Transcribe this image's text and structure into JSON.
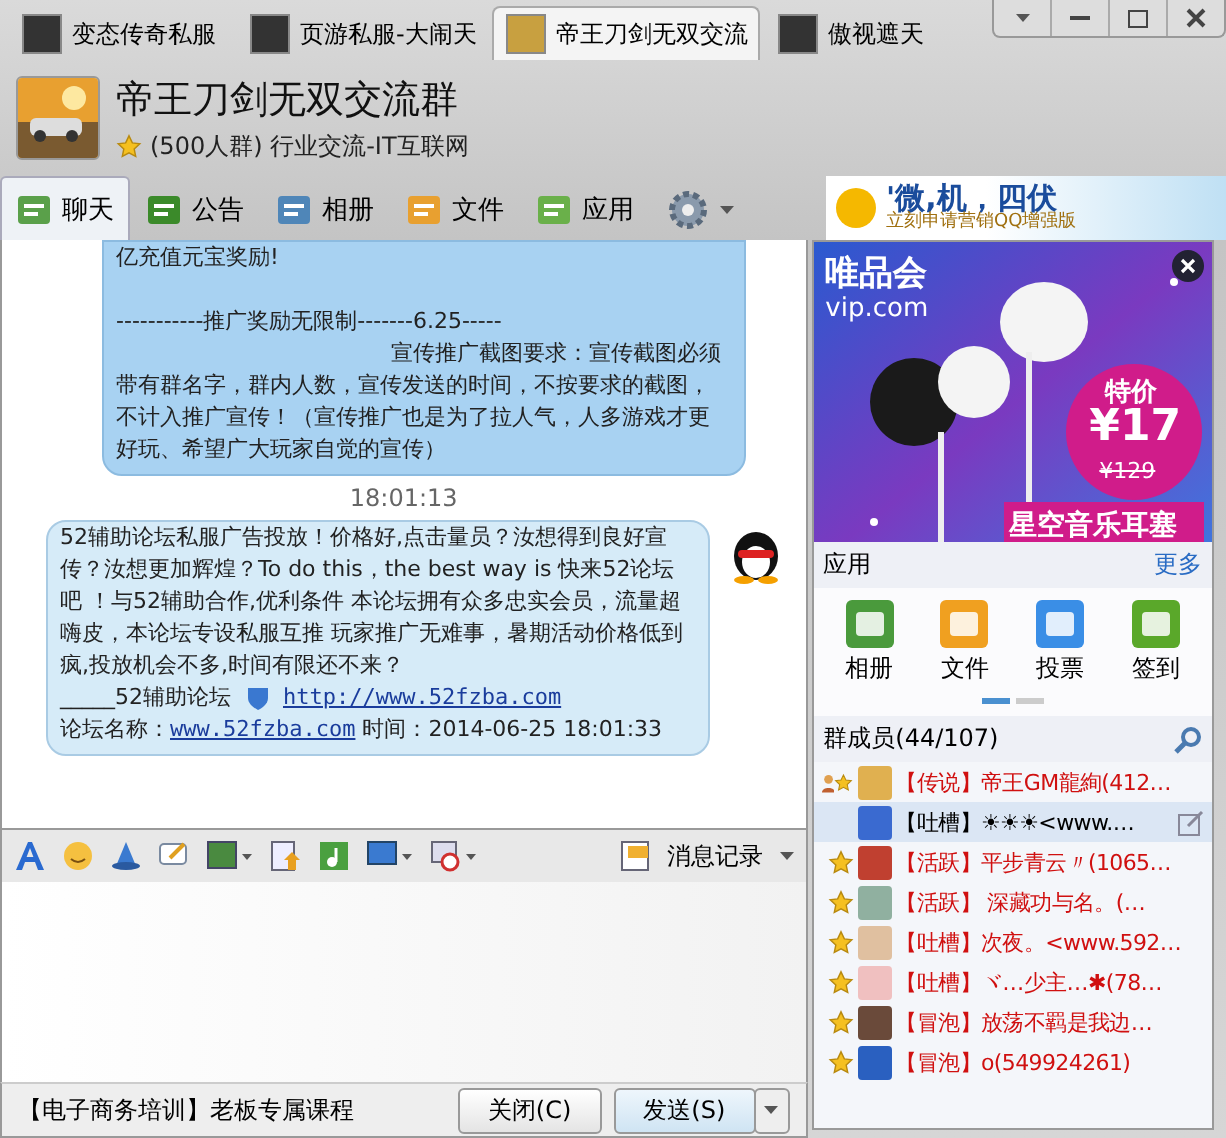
{
  "tabs": [
    {
      "label": "变态传奇私服",
      "selected": false
    },
    {
      "label": "页游私服-大闹天",
      "selected": false
    },
    {
      "label": "帝王刀剑无双交流",
      "selected": true
    },
    {
      "label": "傲视遮天",
      "selected": false
    }
  ],
  "group": {
    "title": "帝王刀剑无双交流群",
    "subtitle": "(500人群) 行业交流-IT互联网"
  },
  "nav": [
    {
      "label": "聊天",
      "selected": true
    },
    {
      "label": "公告",
      "selected": false
    },
    {
      "label": "相册",
      "selected": false
    },
    {
      "label": "文件",
      "selected": false
    },
    {
      "label": "应用",
      "selected": false
    }
  ],
  "banner": {
    "headline": "'微,机，四伏",
    "tagline": "立刻申请营销QQ增强版"
  },
  "messages": [
    {
      "kind": "outgoing",
      "lines": [
        "亿充值元宝奖励!",
        "-----------推广奖励无限制-------6.25-----"
      ],
      "body": "宣传推广截图要求：宣传截图必须带有群名字，群内人数，宣传发送的时间，不按要求的截图，不计入推广宣传！（宣传推广也是为了拉人气，人多游戏才更好玩、希望广大玩家自觉的宣传）"
    },
    {
      "kind": "time",
      "text": "18:01:13"
    },
    {
      "kind": "incoming",
      "body": "52辅助论坛私服广告投放！价格好,点击量员？汝想得到良好宣传？汝想更加辉煌？To do this，the best way is 快来52论坛吧 ！与52辅助合作,优利条件 本论坛拥有众多忠实会员，流量超嗨皮，本论坛专设私服互推 玩家推广无难事，暑期活动价格低到疯,投放机会不多,时间有限还不来？",
      "sign": "_____52辅助论坛",
      "sign_link": "http://www.52fzba.com",
      "name_label": "论坛名称：",
      "name_link": "www.52fzba.com",
      "time": "时间：2014-06-25 18:01:33"
    }
  ],
  "toolbar": {
    "history": "消息记录"
  },
  "footer": {
    "promo": "【电子商务培训】老板专属课程",
    "buttons": [
      "关闭(C)",
      "发送(S)"
    ]
  },
  "ad": {
    "brand": "唯品会",
    "domain": "vip.com",
    "deal": "特价",
    "price": "¥17",
    "old_price": "¥129",
    "product": "星空音乐耳塞"
  },
  "apps": {
    "title": "应用",
    "more": "更多",
    "items": [
      {
        "label": "相册",
        "color": "#4a9a3c"
      },
      {
        "label": "文件",
        "color": "#f0a020"
      },
      {
        "label": "投票",
        "color": "#3a8ee6"
      },
      {
        "label": "签到",
        "color": "#5aa82a"
      }
    ]
  },
  "members": {
    "title": "群成员(44/107)",
    "items": [
      {
        "kind": "owner",
        "tag": "【传说】",
        "name": "帝王GM龍絢(412…",
        "color": "#d01010",
        "selected": false
      },
      {
        "kind": "plain",
        "tag": "【吐槽】",
        "name": "☀☀☀<www.…",
        "color": "#000000",
        "selected": true
      },
      {
        "kind": "star",
        "tag": "【活跃】",
        "name": "平步青云〃(1065…",
        "color": "#d01010",
        "selected": false
      },
      {
        "kind": "star",
        "tag": "【活跃】",
        "name": " 深藏功与名。(…",
        "color": "#d01010",
        "selected": false
      },
      {
        "kind": "star",
        "tag": "【吐槽】",
        "name": "次夜。<www.592…",
        "color": "#d01010",
        "selected": false
      },
      {
        "kind": "star",
        "tag": "【吐槽】",
        "name": "ヾ…少主…✱(78…",
        "color": "#d01010",
        "selected": false
      },
      {
        "kind": "star",
        "tag": "【冒泡】",
        "name": "放荡不羁是我边…",
        "color": "#d01010",
        "selected": false
      },
      {
        "kind": "star",
        "tag": "【冒泡】",
        "name": "o(549924261)",
        "color": "#d01010",
        "selected": false
      }
    ]
  }
}
